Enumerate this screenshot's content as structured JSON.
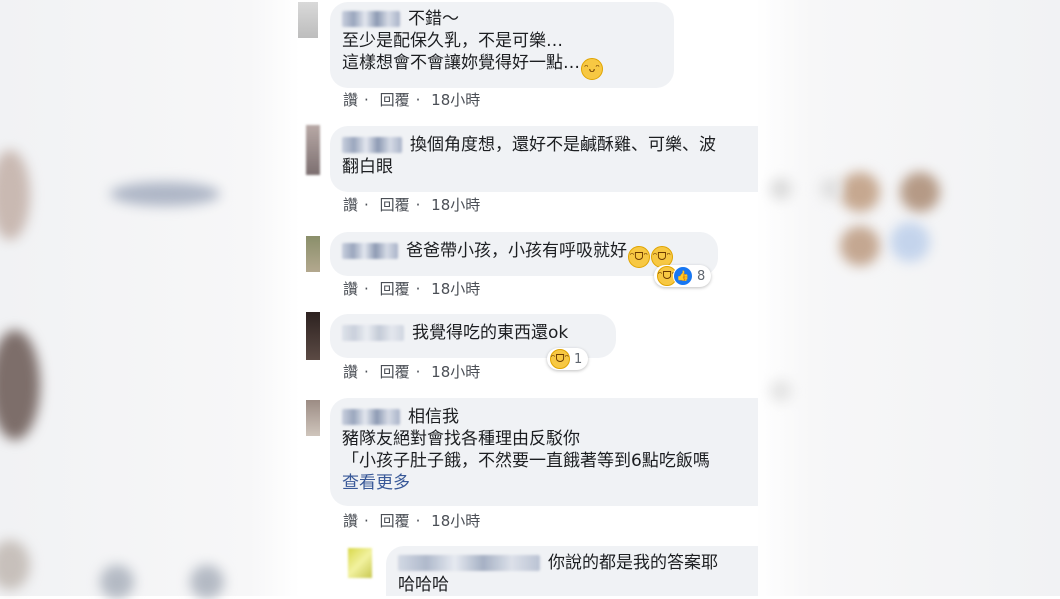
{
  "comments": [
    {
      "lines": [
        "不錯～",
        "至少是配保久乳，不是可樂…",
        "這樣想會不會讓妳覺得好一點…"
      ],
      "emoji": [
        "grinning-sweat-emoji"
      ],
      "actions": {
        "like": "讚",
        "reply": "回覆",
        "time": "18小時"
      }
    },
    {
      "lines": [
        "換個角度想，還好不是鹹酥雞、可樂、波",
        "翻白眼"
      ],
      "actions": {
        "like": "讚",
        "reply": "回覆",
        "time": "18小時"
      }
    },
    {
      "lines": [
        "爸爸帶小孩，小孩有呼吸就好"
      ],
      "emoji": [
        "tears-of-joy-emoji",
        "tears-of-joy-emoji"
      ],
      "reaction_count": "8",
      "actions": {
        "like": "讚",
        "reply": "回覆",
        "time": "18小時"
      }
    },
    {
      "lines": [
        "我覺得吃的東西還ok"
      ],
      "reaction_count": "1",
      "actions": {
        "like": "讚",
        "reply": "回覆",
        "time": "18小時"
      }
    },
    {
      "lines": [
        "相信我",
        "豬隊友絕對會找各種理由反駁你",
        "「小孩子肚子餓，不然要一直餓著等到6點吃飯嗎"
      ],
      "see_more": "查看更多",
      "actions": {
        "like": "讚",
        "reply": "回覆",
        "time": "18小時"
      }
    }
  ],
  "reply": {
    "lines": [
      "你說的都是我的答案耶",
      "哈哈哈"
    ]
  },
  "colors": {
    "bubble": "#f0f2f5",
    "link": "#385898",
    "meta": "#4b4f56",
    "like_blue": "#1877f2",
    "emoji_yellow": "#f7c843"
  }
}
